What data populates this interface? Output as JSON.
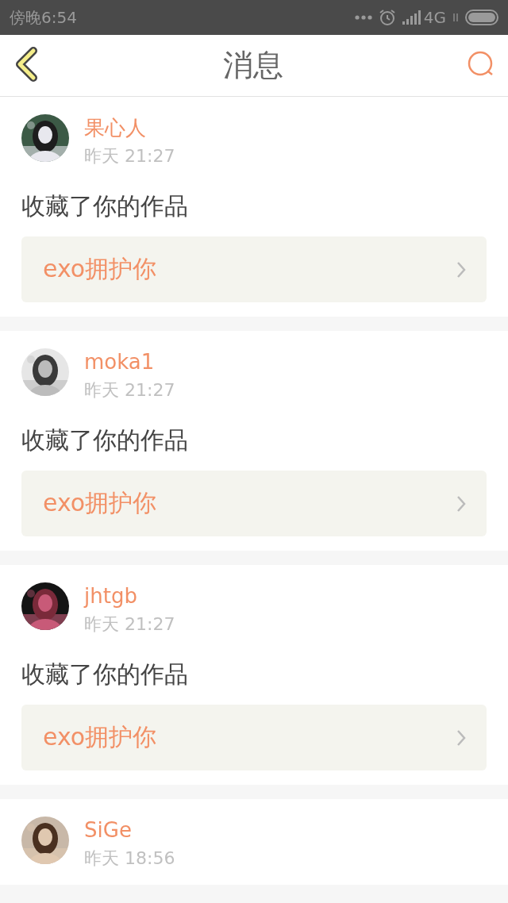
{
  "status_bar": {
    "time": "傍晚6:54",
    "network": "4G"
  },
  "header": {
    "title": "消息"
  },
  "messages": [
    {
      "user": "果心人",
      "time": "昨天 21:27",
      "action": "收藏了你的作品",
      "work": "exo拥护你"
    },
    {
      "user": "moka1",
      "time": "昨天 21:27",
      "action": "收藏了你的作品",
      "work": "exo拥护你"
    },
    {
      "user": "jhtgb",
      "time": "昨天 21:27",
      "action": "收藏了你的作品",
      "work": "exo拥护你"
    },
    {
      "user": "SiGe",
      "time": "昨天 18:56"
    }
  ]
}
